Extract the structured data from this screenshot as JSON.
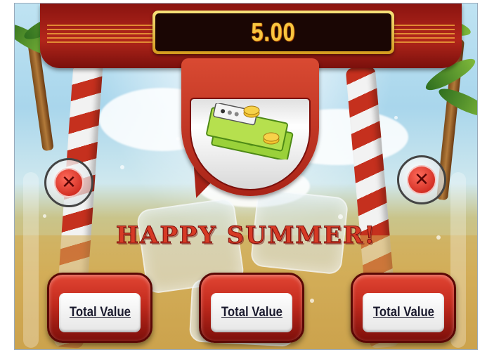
{
  "header": {
    "bet_value": "5.00"
  },
  "title": "HAPPY SUMMER!",
  "center_icon": "money-bills-icon",
  "close_buttons": [
    {
      "icon": "close-icon",
      "glyph": "✕"
    },
    {
      "icon": "close-icon",
      "glyph": "✕"
    }
  ],
  "choices": [
    {
      "label": "Total Value"
    },
    {
      "label": "Total Value"
    },
    {
      "label": "Total Value"
    }
  ],
  "colors": {
    "banner_red": "#b3261b",
    "display_gold": "#f7c640",
    "title_red": "#d63a25",
    "button_red": "#c12a1d"
  }
}
